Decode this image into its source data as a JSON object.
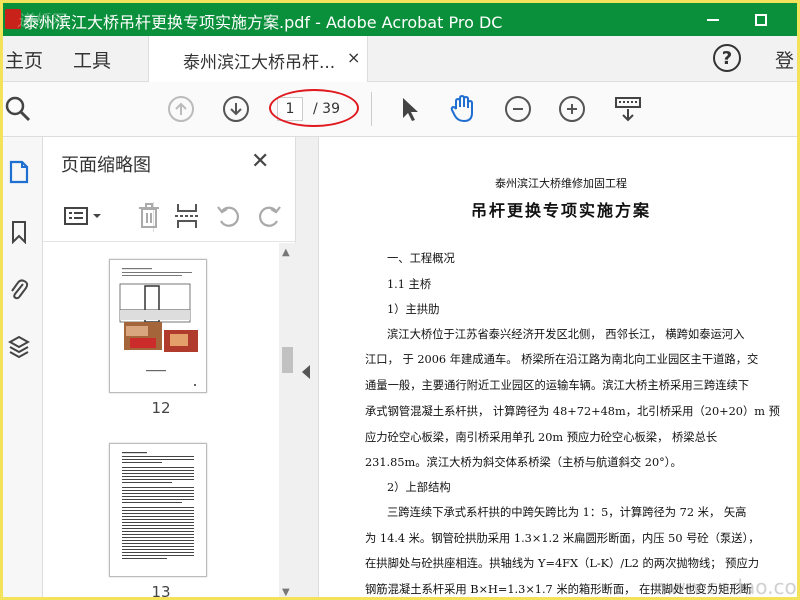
{
  "window": {
    "title": "泰州滨江大桥吊杆更换专项实施方案.pdf - Adobe Acrobat Pro DC",
    "watermark": "道桥网"
  },
  "tabs": {
    "home": "主页",
    "tools": "工具",
    "document": "泰州滨江大桥吊杆...",
    "close": "×",
    "login": "登"
  },
  "toolbar": {
    "page_current": "1",
    "page_total": "/ 39"
  },
  "panel": {
    "title": "页面缩略图",
    "close": "✕",
    "thumbnails": [
      {
        "page": "12"
      },
      {
        "page": "13"
      }
    ]
  },
  "document": {
    "subtitle": "泰州滨江大桥维修加固工程",
    "title": "吊杆更换专项实施方案",
    "lines": [
      "一、工程概况",
      "1.1  主桥",
      "1）主拱肋",
      "滨江大桥位于江苏省泰兴经济开发区北侧，  西邻长江，  横跨如泰运河入",
      "江口，  于 2006 年建成通车。  桥梁所在沿江路为南北向工业园区主干道路，交",
      "通量一般，主要通行附近工业园区的运输车辆。滨江大桥主桥采用三跨连续下",
      "承式钢管混凝土系杆拱，  计算跨径为 48+72+48m，北引桥采用（20+20）m  预",
      "应力砼空心板梁，南引桥采用单孔  20m   预应力砼空心板梁，   桥梁总长",
      "231.85m。滨江大桥为斜交体系桥梁（主桥与航道斜交 20°）。",
      "2）上部结构",
      "三跨连续下承式系杆拱的中跨矢跨比为 1：5，计算跨径为 72 米，  矢高",
      "为 14.4 米。钢管砼拱肋采用 1.3×1.2 米扁圆形断面，内压 50 号砼（泵送），",
      "在拱脚处与砼拱座相连。拱轴线为 Y=4FX（L-K）/L2 的两次抛物线；  预应力",
      "钢筋混凝土系杆采用 B×H=1.3×1.7 米的箱形断面，  在拱脚处也变为矩形断"
    ]
  },
  "watermark_br": "www.cndao.com"
}
